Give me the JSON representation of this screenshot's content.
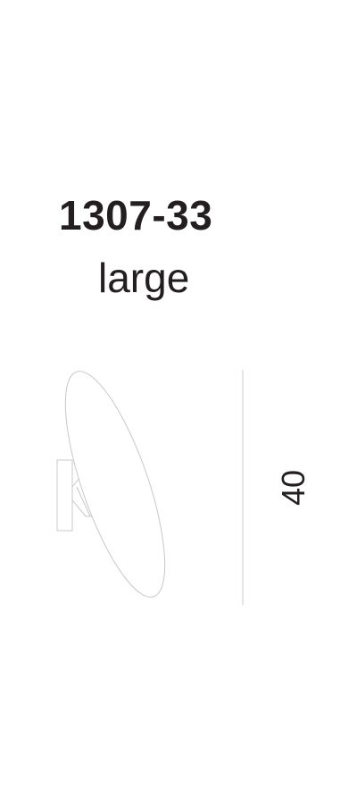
{
  "product": {
    "code": "1307-33",
    "size": "large"
  },
  "dimension": {
    "height_value": "40"
  },
  "colors": {
    "text": "#231f20",
    "line": "#bfbfbf"
  }
}
